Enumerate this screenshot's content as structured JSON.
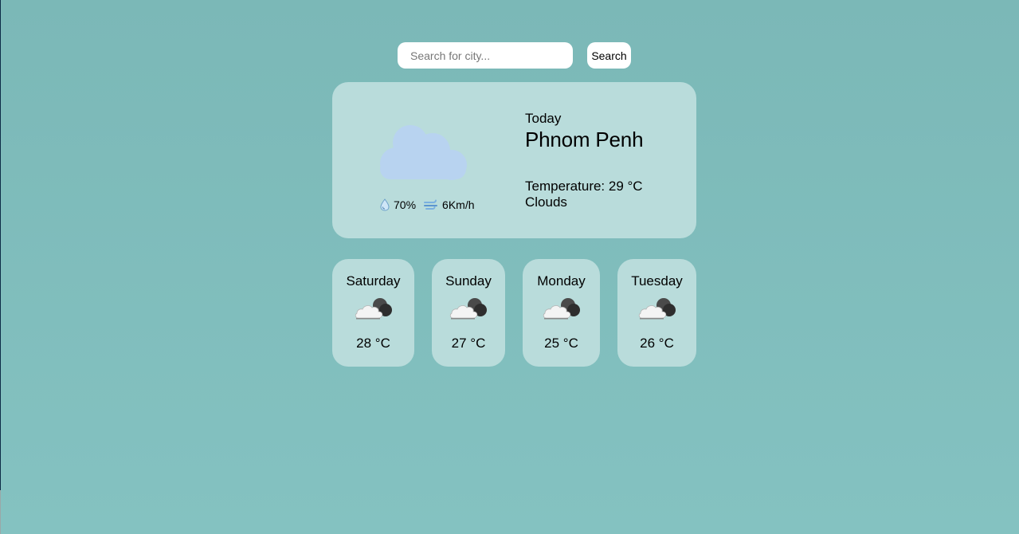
{
  "search": {
    "placeholder": "Search for city...",
    "value": "",
    "button_label": "Search"
  },
  "current": {
    "icon": "cloud-icon",
    "humidity": "70%",
    "wind": "6Km/h",
    "today_label": "Today",
    "city": "Phnom Penh",
    "temperature": "Temperature: 29 °C",
    "condition": "Clouds"
  },
  "forecast": [
    {
      "day": "Saturday",
      "icon": "sun-behind-cloud-icon",
      "temp": "28 °C"
    },
    {
      "day": "Sunday",
      "icon": "sun-behind-cloud-icon",
      "temp": "27 °C"
    },
    {
      "day": "Monday",
      "icon": "sun-behind-cloud-icon",
      "temp": "25 °C"
    },
    {
      "day": "Tuesday",
      "icon": "sun-behind-cloud-icon",
      "temp": "26 °C"
    }
  ],
  "colors": {
    "background": "#7bb8b7",
    "card": "#b9dcdb",
    "cloud": "#b8d3f0"
  }
}
